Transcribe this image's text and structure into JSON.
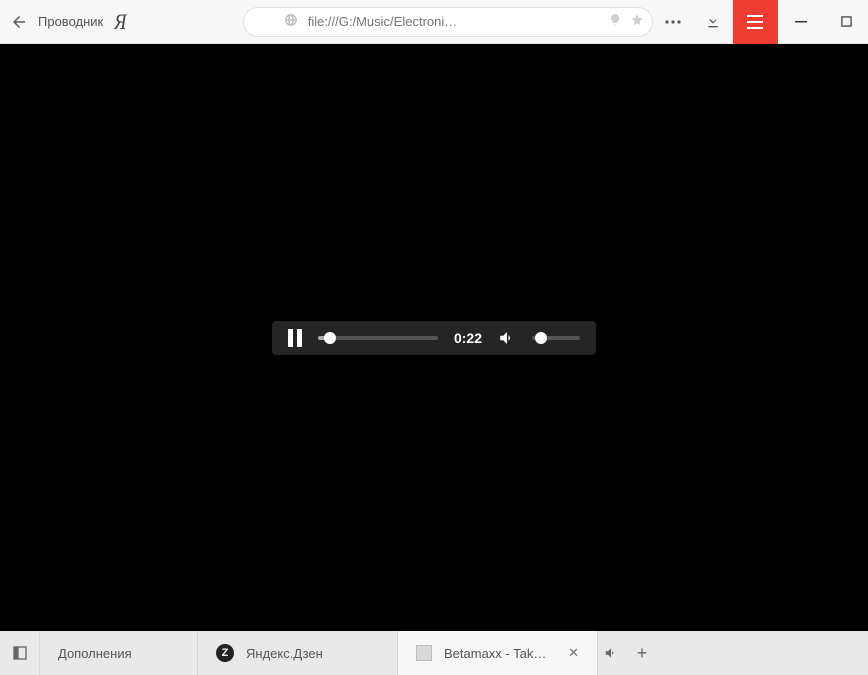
{
  "topbar": {
    "tab_origin": "Проводник",
    "logo_char": "Я",
    "address": "file:///G:/Music/Electroni…"
  },
  "player": {
    "time": "0:22"
  },
  "bottom": {
    "addons_label": "Дополнения",
    "zen_label": "Яндекс.Дзен",
    "zen_badge": "Z",
    "active_tab_label": "Betamaxx - Take Me B",
    "close_glyph": "✕",
    "newtab_glyph": "+"
  }
}
